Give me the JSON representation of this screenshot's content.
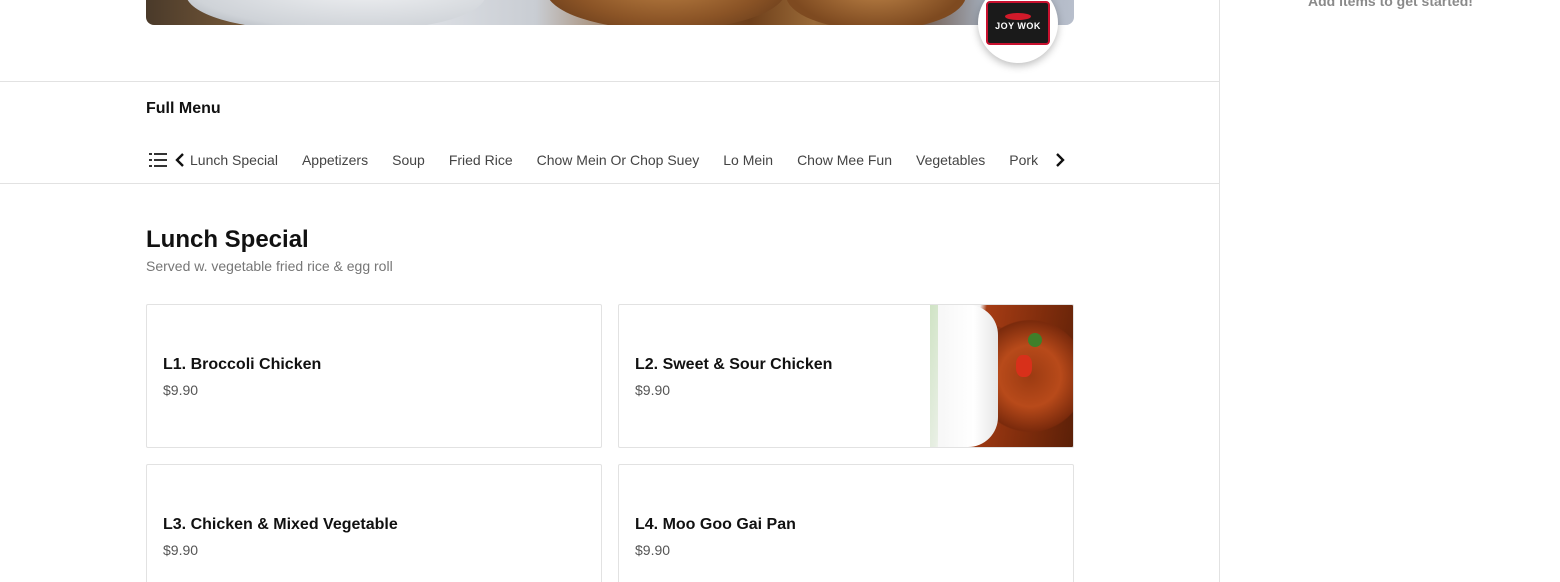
{
  "hero": {
    "logo": {
      "name": "JOY WOK"
    }
  },
  "menu": {
    "title": "Full Menu",
    "categories": [
      "Lunch Special",
      "Appetizers",
      "Soup",
      "Fried Rice",
      "Chow Mein Or Chop Suey",
      "Lo Mein",
      "Chow Mee Fun",
      "Vegetables",
      "Pork"
    ]
  },
  "section": {
    "title": "Lunch Special",
    "subtitle": "Served w. vegetable fried rice & egg roll",
    "items": [
      {
        "name": "L1. Broccoli Chicken",
        "price": "$9.90"
      },
      {
        "name": "L2. Sweet & Sour Chicken",
        "price": "$9.90"
      },
      {
        "name": "L3. Chicken & Mixed Vegetable",
        "price": "$9.90"
      },
      {
        "name": "L4. Moo Goo Gai Pan",
        "price": "$9.90"
      }
    ]
  },
  "cart": {
    "empty_text": "Add items to get started!"
  }
}
